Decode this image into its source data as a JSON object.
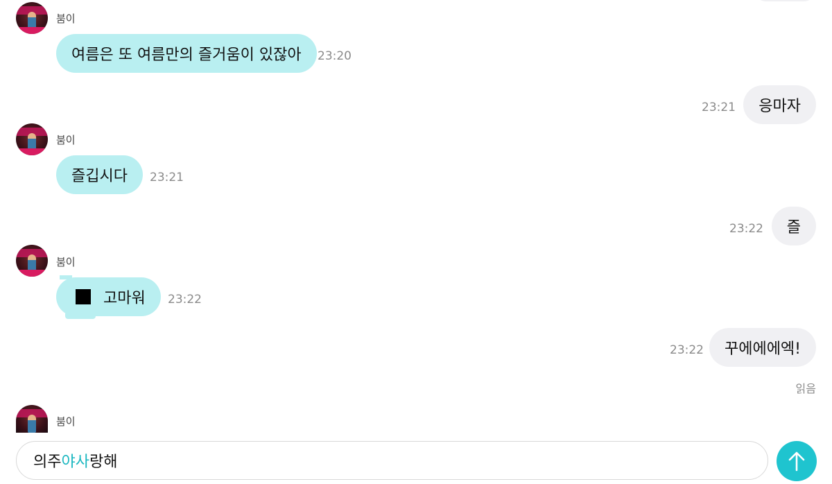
{
  "chat": {
    "messages": [
      {
        "sender": "붐이",
        "text": "여름은 또 여름만의 즐거움이 있잖아",
        "time": "23:20"
      },
      {
        "text": "응마자",
        "time": "23:21"
      },
      {
        "sender": "붐이",
        "text": "즐깁시다",
        "time": "23:21"
      },
      {
        "text": "즐",
        "time": "23:22"
      },
      {
        "sender": "붐이",
        "text": "고마워",
        "time": "23:22",
        "emoji": "black-square-emoji"
      },
      {
        "text": "꾸에에에엑!",
        "time": "23:22"
      },
      {
        "sender": "붐이"
      }
    ],
    "read_label": "읽음"
  },
  "composer": {
    "text_part1": "의주",
    "text_highlight": "야사",
    "text_part2": "랑해",
    "highlight_color": "#1ab7c0",
    "send_icon": "arrow-up-icon",
    "send_color": "#1fc4cf"
  },
  "colors": {
    "incoming_bubble": "#b9eff1",
    "outgoing_bubble": "#f0f0f3"
  }
}
